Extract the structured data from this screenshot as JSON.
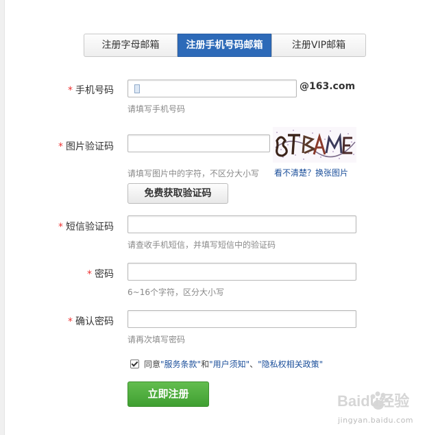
{
  "tabs": [
    {
      "label": "注册字母邮箱",
      "active": false
    },
    {
      "label": "注册手机号码邮箱",
      "active": true
    },
    {
      "label": "注册VIP邮箱",
      "active": false
    }
  ],
  "required_mark": "*",
  "phone": {
    "label": "手机号码",
    "value": "",
    "suffix": "@163.com",
    "hint": "请填写手机号码"
  },
  "captcha": {
    "label": "图片验证码",
    "value": "",
    "hint": "请填写图片中的字符，不区分大小写",
    "refresh_label": "看不清楚？换张图片"
  },
  "get_code_button": "免费获取验证码",
  "sms": {
    "label": "短信验证码",
    "value": "",
    "hint": "请查收手机短信，并填写短信中的验证码"
  },
  "password": {
    "label": "密码",
    "value": "",
    "hint": "6~16个字符，区分大小写"
  },
  "confirm_password": {
    "label": "确认密码",
    "value": "",
    "hint": "请再次填写密码"
  },
  "agreement": {
    "checked": true,
    "prefix": "同意",
    "term1": "\"服务条款\"",
    "and": "和",
    "term2": "\"用户须知\"",
    "sep": "、",
    "term3": "\"隐私权相关政策\""
  },
  "submit_button": "立即注册",
  "watermark": {
    "brand": "Baidu经验",
    "domain": "jingyan.baidu.com"
  },
  "colors": {
    "accent": "#2d6ab8",
    "submit": "#4cae3c",
    "required": "#e33333",
    "link": "#1a4e9a"
  }
}
